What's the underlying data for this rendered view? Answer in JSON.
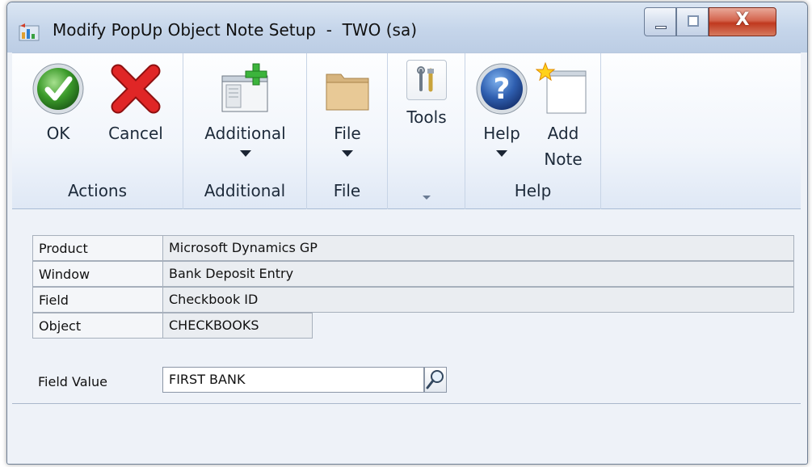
{
  "window": {
    "title": "Modify PopUp Object Note Setup  -  TWO (sa)",
    "close_glyph": "X"
  },
  "ribbon": {
    "groups": [
      {
        "label": "Actions",
        "buttons": [
          {
            "label": "OK",
            "icon": "ok-check-icon"
          },
          {
            "label": "Cancel",
            "icon": "cancel-x-icon"
          }
        ]
      },
      {
        "label": "Additional",
        "buttons": [
          {
            "label": "Additional",
            "icon": "additional-window-icon",
            "dropdown": true
          }
        ]
      },
      {
        "label": "File",
        "buttons": [
          {
            "label": "File",
            "icon": "folder-icon",
            "dropdown": true
          }
        ]
      },
      {
        "label": "",
        "buttons": [
          {
            "label": "Tools",
            "icon": "tools-icon"
          }
        ]
      },
      {
        "label": "Help",
        "buttons": [
          {
            "label": "Help",
            "icon": "help-question-icon",
            "dropdown": true
          },
          {
            "label_line1": "Add",
            "label_line2": "Note",
            "icon": "add-note-icon"
          }
        ]
      }
    ]
  },
  "form": {
    "product": {
      "label": "Product",
      "value": "Microsoft Dynamics GP"
    },
    "window": {
      "label": "Window",
      "value": "Bank Deposit Entry"
    },
    "field": {
      "label": "Field",
      "value": "Checkbook ID"
    },
    "object": {
      "label": "Object",
      "value": "CHECKBOOKS"
    },
    "field_value": {
      "label": "Field Value",
      "value": "FIRST BANK"
    }
  },
  "colors": {
    "accent": "#2f6fc0",
    "ok_green": "#3b9a2a",
    "cancel_red": "#d21f1f",
    "close_red": "#c0391f"
  }
}
